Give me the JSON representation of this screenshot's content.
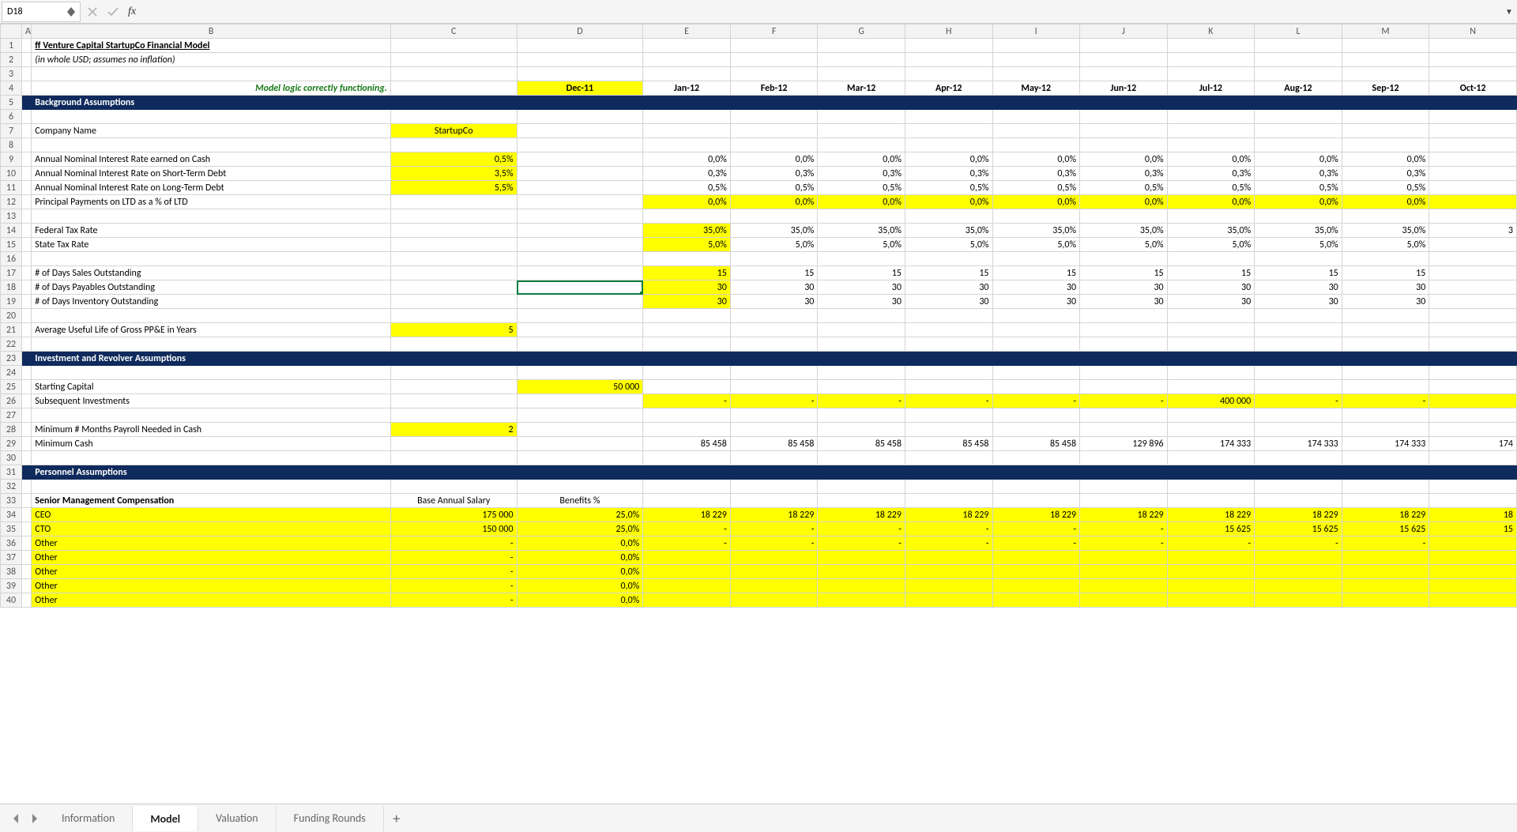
{
  "name_box": "D18",
  "formula_value": "",
  "col_headers": [
    "A",
    "B",
    "C",
    "D",
    "E",
    "F",
    "G",
    "H",
    "I",
    "J",
    "K",
    "L",
    "M",
    "N"
  ],
  "months": [
    "Dec-11",
    "Jan-12",
    "Feb-12",
    "Mar-12",
    "Apr-12",
    "May-12",
    "Jun-12",
    "Jul-12",
    "Aug-12",
    "Sep-12",
    "Oct-12"
  ],
  "rows": {
    "1": {
      "B": "ff Venture Capital StartupCo Financial Model"
    },
    "2": {
      "B": "(in whole USD; assumes no inflation)"
    },
    "4": {
      "B": "Model logic correctly functioning."
    },
    "5": {
      "B": "Background Assumptions"
    },
    "7": {
      "B": "Company Name",
      "C": "StartupCo"
    },
    "9": {
      "B": "Annual Nominal Interest Rate earned on Cash",
      "C": "0,5%",
      "months": [
        "0,0%",
        "0,0%",
        "0,0%",
        "0,0%",
        "0,0%",
        "0,0%",
        "0,0%",
        "0,0%",
        "0,0%",
        ""
      ]
    },
    "10": {
      "B": "Annual Nominal Interest Rate on Short-Term Debt",
      "C": "3,5%",
      "months": [
        "0,3%",
        "0,3%",
        "0,3%",
        "0,3%",
        "0,3%",
        "0,3%",
        "0,3%",
        "0,3%",
        "0,3%",
        ""
      ]
    },
    "11": {
      "B": "Annual Nominal Interest Rate on Long-Term Debt",
      "C": "5,5%",
      "months": [
        "0,5%",
        "0,5%",
        "0,5%",
        "0,5%",
        "0,5%",
        "0,5%",
        "0,5%",
        "0,5%",
        "0,5%",
        ""
      ]
    },
    "12": {
      "B": "Principal Payments on LTD as a % of LTD",
      "months": [
        "0,0%",
        "0,0%",
        "0,0%",
        "0,0%",
        "0,0%",
        "0,0%",
        "0,0%",
        "0,0%",
        "0,0%",
        ""
      ]
    },
    "14": {
      "B": "Federal Tax Rate",
      "months": [
        "35,0%",
        "35,0%",
        "35,0%",
        "35,0%",
        "35,0%",
        "35,0%",
        "35,0%",
        "35,0%",
        "35,0%",
        "3"
      ]
    },
    "15": {
      "B": "State Tax Rate",
      "months": [
        "5,0%",
        "5,0%",
        "5,0%",
        "5,0%",
        "5,0%",
        "5,0%",
        "5,0%",
        "5,0%",
        "5,0%",
        ""
      ]
    },
    "17": {
      "B": "# of Days Sales Outstanding",
      "months": [
        "15",
        "15",
        "15",
        "15",
        "15",
        "15",
        "15",
        "15",
        "15",
        ""
      ]
    },
    "18": {
      "B": "# of Days Payables Outstanding",
      "months": [
        "30",
        "30",
        "30",
        "30",
        "30",
        "30",
        "30",
        "30",
        "30",
        ""
      ]
    },
    "19": {
      "B": "# of Days Inventory Outstanding",
      "months": [
        "30",
        "30",
        "30",
        "30",
        "30",
        "30",
        "30",
        "30",
        "30",
        ""
      ]
    },
    "21": {
      "B": "Average Useful Life of Gross PP&E in Years",
      "C": "5"
    },
    "23": {
      "B": "Investment and Revolver Assumptions"
    },
    "25": {
      "B": "Starting Capital",
      "D": "50 000"
    },
    "26": {
      "B": "Subsequent Investments",
      "months": [
        "-",
        "-",
        "-",
        "-",
        "-",
        "-",
        "400 000",
        "-",
        "-",
        ""
      ]
    },
    "28": {
      "B": "Minimum # Months Payroll Needed in Cash",
      "C": "2"
    },
    "29": {
      "B": "Minimum Cash",
      "months": [
        "85 458",
        "85 458",
        "85 458",
        "85 458",
        "85 458",
        "129 896",
        "174 333",
        "174 333",
        "174 333",
        "174"
      ]
    },
    "31": {
      "B": "Personnel Assumptions"
    },
    "33": {
      "B": "Senior Management Compensation",
      "C": "Base Annual Salary",
      "D": "Benefits %"
    },
    "34": {
      "B": "CEO",
      "C": "175 000",
      "D": "25,0%",
      "months": [
        "18 229",
        "18 229",
        "18 229",
        "18 229",
        "18 229",
        "18 229",
        "18 229",
        "18 229",
        "18 229",
        "18"
      ]
    },
    "35": {
      "B": "CTO",
      "C": "150 000",
      "D": "25,0%",
      "months": [
        "-",
        "-",
        "-",
        "-",
        "-",
        "-",
        "15 625",
        "15 625",
        "15 625",
        "15"
      ]
    },
    "36": {
      "B": "Other",
      "C": "-",
      "D": "0,0%",
      "months": [
        "-",
        "-",
        "-",
        "-",
        "-",
        "-",
        "-",
        "-",
        "-",
        ""
      ]
    },
    "37": {
      "B": "Other",
      "C": "-",
      "D": "0,0%",
      "months": [
        "",
        "",
        "",
        "",
        "",
        "",
        "",
        "",
        "",
        ""
      ]
    },
    "38": {
      "B": "Other",
      "C": "-",
      "D": "0,0%",
      "months": [
        "",
        "",
        "",
        "",
        "",
        "",
        "",
        "",
        "",
        ""
      ]
    },
    "39": {
      "B": "Other",
      "C": "-",
      "D": "0,0%",
      "months": [
        "",
        "",
        "",
        "",
        "",
        "",
        "",
        "",
        "",
        ""
      ]
    },
    "40": {
      "B": "Other",
      "C": "-",
      "D": "0,0%",
      "months": [
        "",
        "",
        "",
        "",
        "",
        "",
        "",
        "",
        "",
        ""
      ]
    }
  },
  "tabs": [
    "Information",
    "Model",
    "Valuation",
    "Funding Rounds"
  ],
  "active_tab": "Model"
}
